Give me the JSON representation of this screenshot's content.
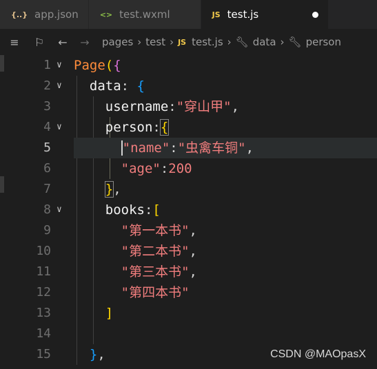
{
  "tabs": [
    {
      "icon": "{..}",
      "label": "app.json",
      "active": false
    },
    {
      "icon": "<>",
      "label": "test.wxml",
      "active": false
    },
    {
      "icon": "JS",
      "label": "test.js",
      "active": true
    }
  ],
  "breadcrumb": {
    "items": [
      "pages",
      "test",
      "test.js",
      "data",
      "person"
    ]
  },
  "editor": {
    "line_numbers": [
      "1",
      "2",
      "3",
      "4",
      "5",
      "6",
      "7",
      "8",
      "9",
      "10",
      "11",
      "12",
      "13",
      "14",
      "15"
    ],
    "current_line": "5",
    "code": {
      "l1_kw": "Page",
      "l2_prop": "data",
      "l3_prop": "username",
      "l3_val": "\"穿山甲\"",
      "l4_prop": "person",
      "l5_key": "\"name\"",
      "l5_val": "\"虫禽车铜\"",
      "l6_key": "\"age\"",
      "l6_val": "200",
      "l8_prop": "books",
      "l9_val": "\"第一本书\"",
      "l10_val": "\"第二本书\"",
      "l11_val": "\"第三本书\"",
      "l12_val": "\"第四本书\""
    }
  },
  "watermark": "CSDN @MAOpasX"
}
